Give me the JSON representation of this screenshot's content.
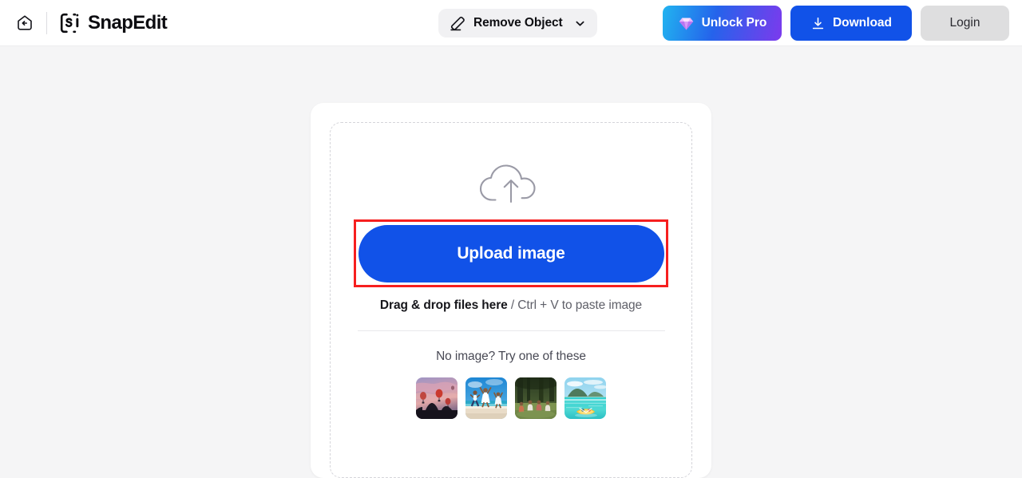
{
  "header": {
    "back_icon": "back-arrow-home-icon",
    "brand": {
      "logo_icon": "snapedit-logo-mark",
      "name": "SnapEdit"
    },
    "tool": {
      "icon": "eraser-icon",
      "label": "Remove Object",
      "chevron_icon": "chevron-down-icon"
    },
    "actions": {
      "unlock_pro": {
        "label": "Unlock Pro",
        "icon": "diamond-gem-icon",
        "gradient_from": "#21b4f0",
        "gradient_mid": "#2563eb",
        "gradient_to": "#7c3aed"
      },
      "download": {
        "label": "Download",
        "icon": "download-arrow-icon",
        "color": "#1152e8"
      },
      "login": {
        "label": "Login",
        "color": "#dededf"
      }
    }
  },
  "main": {
    "dropzone": {
      "cloud_icon": "cloud-upload-icon",
      "upload_label": "Upload image",
      "upload_color": "#1152e8",
      "annotation_color": "#f61f1f",
      "drag_strong": "Drag & drop files here",
      "drag_rest": " / Ctrl + V to paste image",
      "samples_label": "No image? Try one of these",
      "samples": [
        {
          "name": "hot-air-balloons-sunset"
        },
        {
          "name": "beach-couple-jumping"
        },
        {
          "name": "forest-group-picnic"
        },
        {
          "name": "tropical-kayak-lagoon"
        }
      ]
    }
  }
}
